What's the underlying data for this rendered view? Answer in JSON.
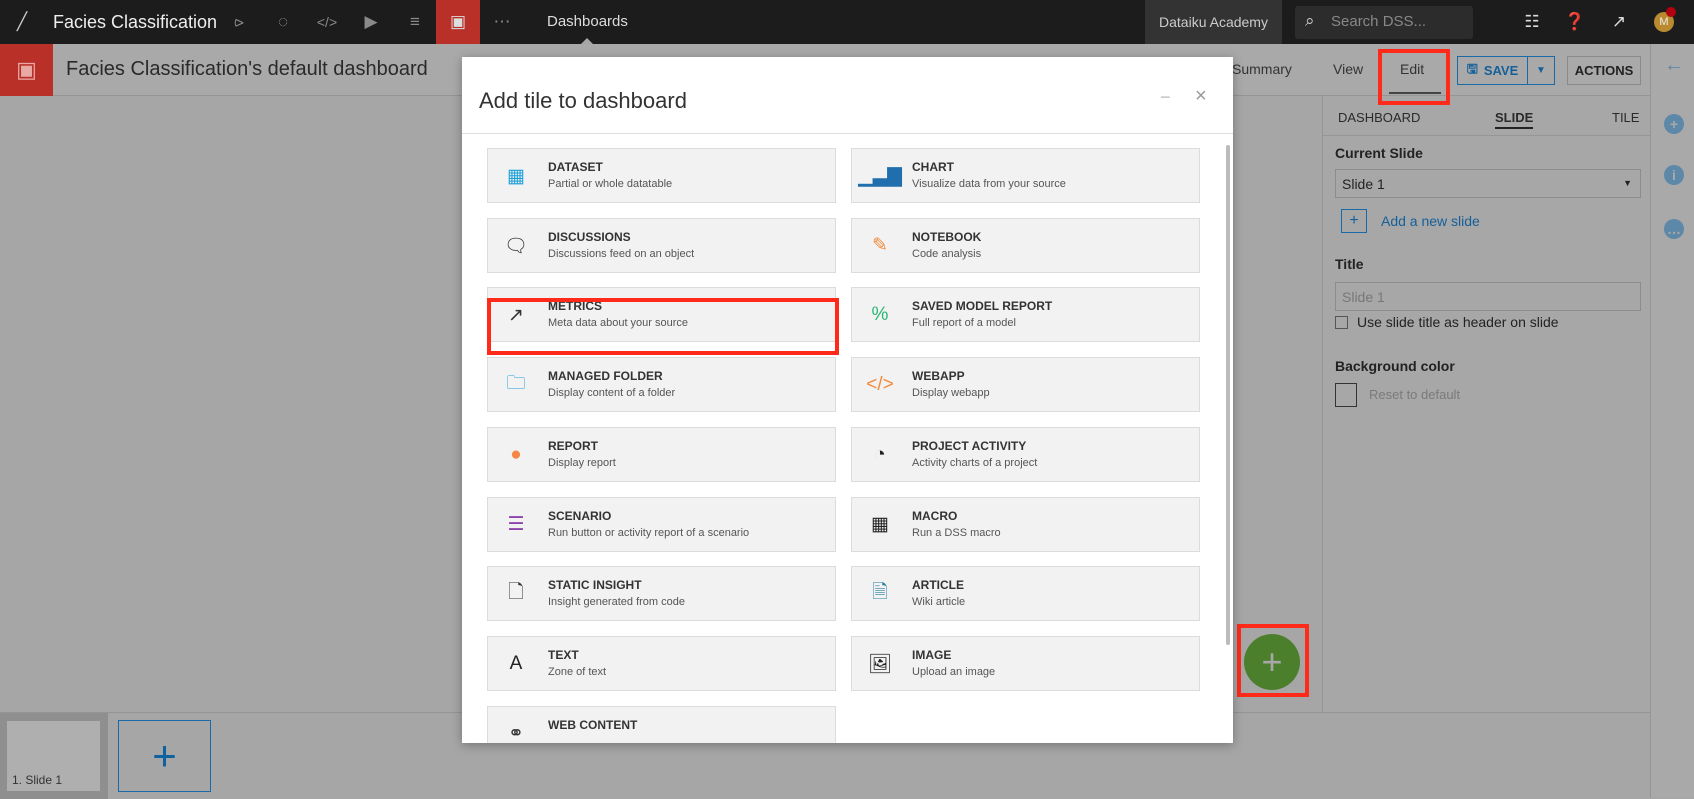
{
  "topbar": {
    "project": "Facies Classification",
    "section": "Dashboards",
    "academy": "Dataiku Academy",
    "search_placeholder": "Search DSS...",
    "avatar": "M"
  },
  "subbar": {
    "title": "Facies Classification's default dashboard",
    "tabs": [
      "Summary",
      "View",
      "Edit"
    ],
    "save": "SAVE",
    "actions": "ACTIONS"
  },
  "panel": {
    "tabs": [
      "DASHBOARD",
      "SLIDE",
      "TILE"
    ],
    "current_slide_label": "Current Slide",
    "current_slide": "Slide 1",
    "add_slide": "Add a new slide",
    "title_label": "Title",
    "title_placeholder": "Slide 1",
    "use_title_label": "Use slide title as header on slide",
    "bg_label": "Background color",
    "reset": "Reset to default"
  },
  "bottom": {
    "slide_thumb": "1. Slide 1",
    "add": "+"
  },
  "fab": "+",
  "modal": {
    "title": "Add tile to dashboard",
    "minimize": "−",
    "close": "×",
    "tiles": [
      {
        "name": "DATASET",
        "desc": "Partial or whole datatable",
        "icon": "table-icon",
        "color": "#1a9fd8"
      },
      {
        "name": "CHART",
        "desc": "Visualize data from your source",
        "icon": "bar-chart-icon",
        "color": "#1f6fae"
      },
      {
        "name": "DISCUSSIONS",
        "desc": "Discussions feed on an object",
        "icon": "comments-icon",
        "color": "#333333"
      },
      {
        "name": "NOTEBOOK",
        "desc": "Code analysis",
        "icon": "notebook-edit-icon",
        "color": "#f28a3c"
      },
      {
        "name": "METRICS",
        "desc": "Meta data about your source",
        "icon": "external-link-icon",
        "color": "#333333"
      },
      {
        "name": "SAVED MODEL REPORT",
        "desc": "Full report of a model",
        "icon": "percent-icon",
        "color": "#2bb673"
      },
      {
        "name": "MANAGED FOLDER",
        "desc": "Display content of a folder",
        "icon": "folder-icon",
        "color": "#1a9fd8"
      },
      {
        "name": "WEBAPP",
        "desc": "Display webapp",
        "icon": "code-icon",
        "color": "#f28a3c"
      },
      {
        "name": "REPORT",
        "desc": "Display report",
        "icon": "rmd-icon",
        "color": "#f58646"
      },
      {
        "name": "PROJECT ACTIVITY",
        "desc": "Activity charts of a project",
        "icon": "dashboard-gauge-icon",
        "color": "#222222"
      },
      {
        "name": "SCENARIO",
        "desc": "Run button or activity report of a scenario",
        "icon": "list-icon",
        "color": "#8e44ad"
      },
      {
        "name": "MACRO",
        "desc": "Run a DSS macro",
        "icon": "grid-icon",
        "color": "#222222"
      },
      {
        "name": "STATIC INSIGHT",
        "desc": "Insight generated from code",
        "icon": "file-icon",
        "color": "#333333"
      },
      {
        "name": "ARTICLE",
        "desc": "Wiki article",
        "icon": "article-icon",
        "color": "#2a7ea3"
      },
      {
        "name": "TEXT",
        "desc": "Zone of text",
        "icon": "text-icon",
        "color": "#222222"
      },
      {
        "name": "IMAGE",
        "desc": "Upload an image",
        "icon": "image-icon",
        "color": "#222222"
      },
      {
        "name": "WEB CONTENT",
        "desc": "",
        "icon": "link-icon",
        "color": "#333333"
      }
    ]
  }
}
